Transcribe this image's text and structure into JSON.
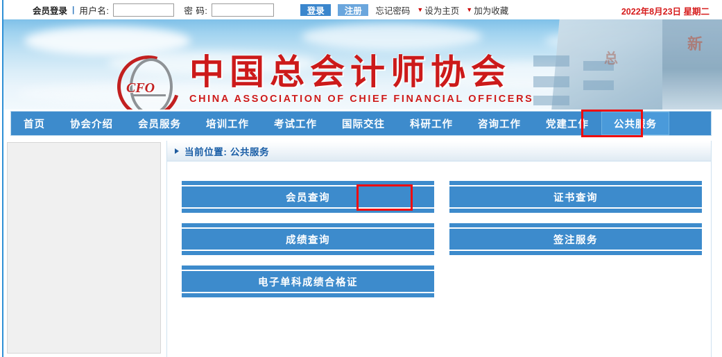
{
  "topbar": {
    "member_login_label": "会员登录",
    "separator": "|",
    "username_label": "用户名:",
    "username_value": "",
    "username_placeholder": "",
    "password_label": "密 码:",
    "password_value": "",
    "password_placeholder": "",
    "login_button": "登录",
    "register_button": "注册",
    "forgot_password": "忘记密码",
    "set_homepage": "设为主页",
    "add_favorite": "加为收藏",
    "date": "2022年8月23日 星期二"
  },
  "banner": {
    "logo_mark_text": "CFO",
    "title_cn": "中国总会计师协会",
    "title_en": "CHINA ASSOCIATION OF CHIEF FINANCIAL OFFICERS",
    "building_text": "新",
    "building_text2": "总"
  },
  "nav": {
    "items": [
      {
        "label": "首页",
        "active": false
      },
      {
        "label": "协会介绍",
        "active": false
      },
      {
        "label": "会员服务",
        "active": false
      },
      {
        "label": "培训工作",
        "active": false
      },
      {
        "label": "考试工作",
        "active": false
      },
      {
        "label": "国际交往",
        "active": false
      },
      {
        "label": "科研工作",
        "active": false
      },
      {
        "label": "咨询工作",
        "active": false
      },
      {
        "label": "党建工作",
        "active": false
      },
      {
        "label": "公共服务",
        "active": true
      }
    ]
  },
  "breadcrumb": {
    "text": "当前位置: 公共服务"
  },
  "services": [
    {
      "label": "会员查询",
      "highlighted": false
    },
    {
      "label": "证书查询",
      "highlighted": true
    },
    {
      "label": "成绩查询",
      "highlighted": false
    },
    {
      "label": "签注服务",
      "highlighted": false
    },
    {
      "label": "电子单科成绩合格证",
      "highlighted": false
    }
  ],
  "colors": {
    "primary_blue": "#3d8bcc",
    "active_nav_blue": "#4a9ada",
    "highlight_red": "#f00c0c",
    "date_red": "#d61b1b",
    "logo_red": "#cc1a1a",
    "crumb_blue": "#1a5ea6",
    "sidebar_gray": "#f0f0f0"
  }
}
